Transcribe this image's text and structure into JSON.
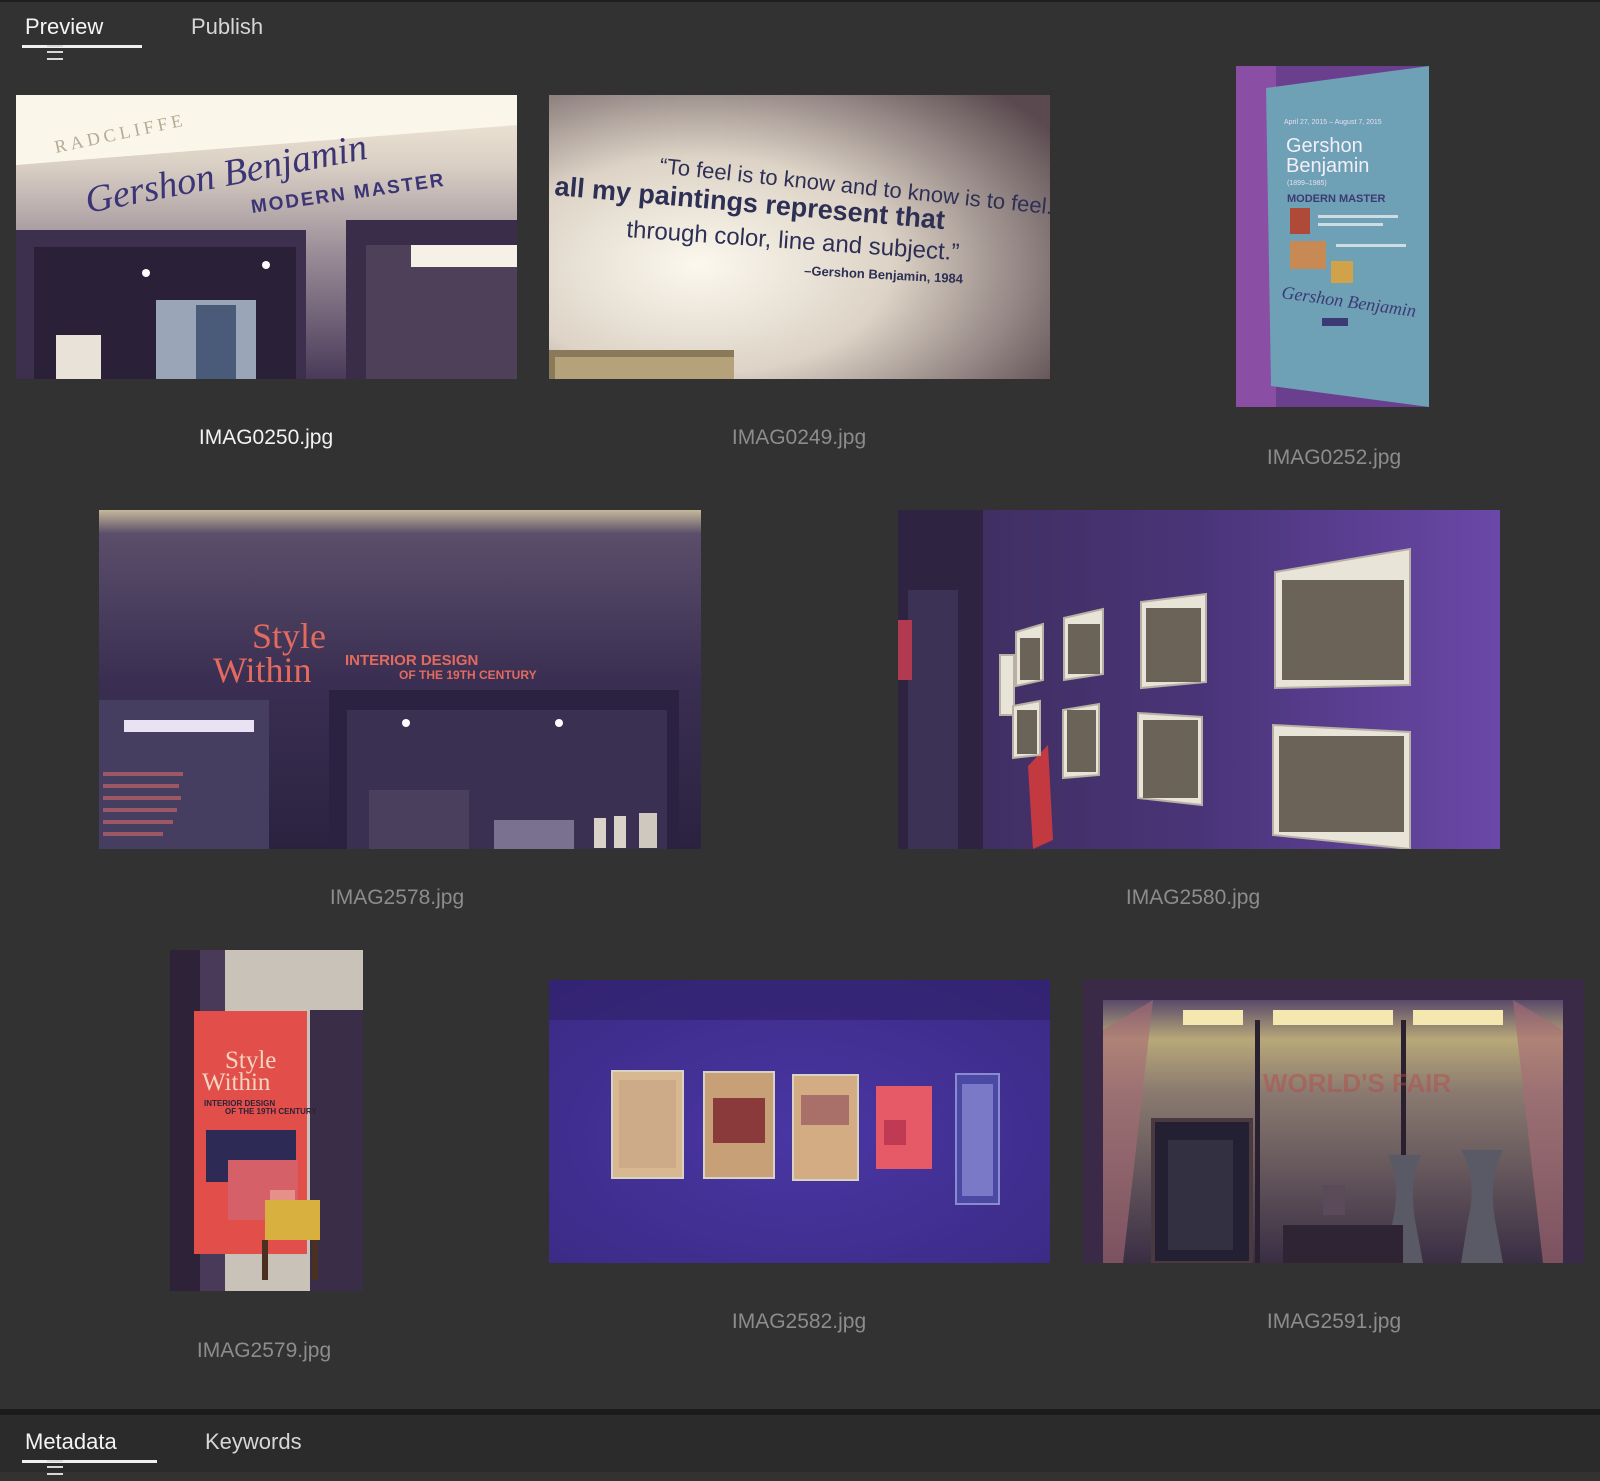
{
  "top_tabs": {
    "preview": "Preview",
    "publish": "Publish"
  },
  "bottom_tabs": {
    "metadata": "Metadata",
    "keywords": "Keywords"
  },
  "thumbnails": [
    {
      "filename": "IMAG0250.jpg",
      "selected": true,
      "image_text": {
        "sign_top": "RADCLIFFE",
        "script": "Gershon Benjamin",
        "caps": "MODERN MASTER"
      }
    },
    {
      "filename": "IMAG0249.jpg",
      "selected": false,
      "image_text": {
        "line1": "“To feel is to know and to know is to feel...",
        "line2": "all my paintings represent that",
        "line3": "through color, line and subject.”",
        "attribution": "–Gershon Benjamin, 1984"
      }
    },
    {
      "filename": "IMAG0252.jpg",
      "selected": false,
      "image_text": {
        "dates": "April 27, 2015 – August 7, 2015",
        "name1": "Gershon",
        "name2": "Benjamin",
        "years": "(1899–1985)",
        "subtitle": "MODERN MASTER"
      }
    },
    {
      "filename": "IMAG2578.jpg",
      "selected": false,
      "image_text": {
        "style": "Style",
        "within": "Within",
        "subtitle1": "INTERIOR DESIGN",
        "subtitle2": "OF THE 19TH CENTURY"
      }
    },
    {
      "filename": "IMAG2580.jpg",
      "selected": false,
      "image_text": {}
    },
    {
      "filename": "IMAG2579.jpg",
      "selected": false,
      "image_text": {
        "style": "Style",
        "within": "Within",
        "subtitle1": "INTERIOR DESIGN",
        "subtitle2": "OF THE 19TH CENTURY"
      }
    },
    {
      "filename": "IMAG2582.jpg",
      "selected": false,
      "image_text": {}
    },
    {
      "filename": "IMAG2591.jpg",
      "selected": false,
      "image_text": {
        "overlay": "WORLD'S FAIR"
      }
    }
  ],
  "colors": {
    "background": "#323232",
    "bottom_bar": "#2b2b2b",
    "filename": "#8c8c8c",
    "filename_selected": "#f2f2f2",
    "active_tab_underline": "#f0f0f0"
  }
}
